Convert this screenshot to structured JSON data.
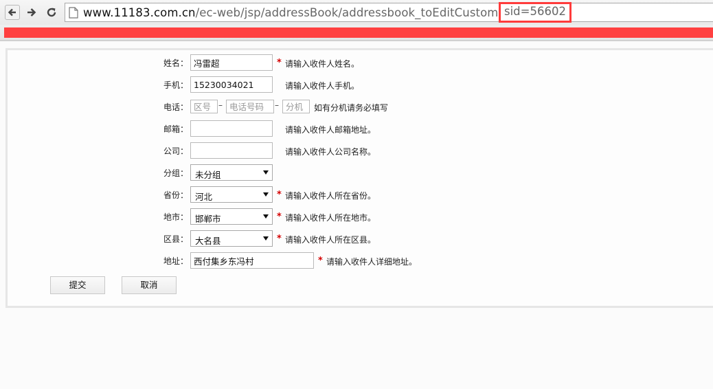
{
  "browser": {
    "url_host": "www.11183.com.cn",
    "url_path": "/ec-web/jsp/addressBook/addressbook_toEditCustom.action?",
    "url_sid": "sid=56602"
  },
  "form": {
    "name": {
      "label": "姓名：",
      "value": "冯雷超",
      "required": "*",
      "hint": "请输入收件人姓名。"
    },
    "mobile": {
      "label": "手机：",
      "value": "15230034021",
      "hint": "请输入收件人手机。"
    },
    "phone": {
      "label": "电话：",
      "area_placeholder": "区号",
      "number_placeholder": "电话号码",
      "ext_placeholder": "分机",
      "dash": "–",
      "hint": "如有分机请务必填写"
    },
    "email": {
      "label": "邮箱：",
      "value": "",
      "hint": "请输入收件人邮箱地址。"
    },
    "company": {
      "label": "公司：",
      "value": "",
      "hint": "请输入收件人公司名称。"
    },
    "group": {
      "label": "分组：",
      "selected": "未分组"
    },
    "province": {
      "label": "省份：",
      "selected": "河北",
      "required": "*",
      "hint": "请输入收件人所在省份。"
    },
    "city": {
      "label": "地市：",
      "selected": "邯郸市",
      "required": "*",
      "hint": "请输入收件人所在地市。"
    },
    "district": {
      "label": "区县：",
      "selected": "大名县",
      "required": "*",
      "hint": "请输入收件人所在区县。"
    },
    "address": {
      "label": "地址：",
      "value": "西付集乡东冯村",
      "required": "*",
      "hint": "请输入收件人详细地址。"
    }
  },
  "buttons": {
    "submit": "提交",
    "cancel": "取消"
  },
  "colors": {
    "required": "#d40000",
    "highlight": "#ff3b3b",
    "redaction": "#ff4040"
  }
}
